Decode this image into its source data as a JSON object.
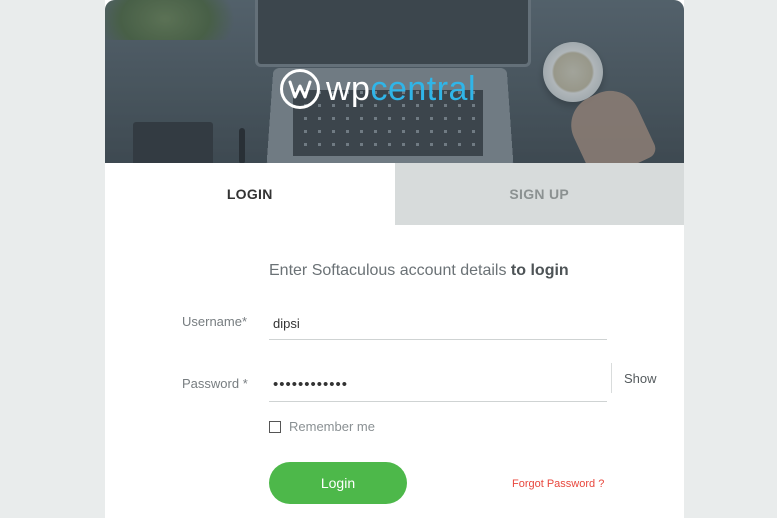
{
  "brand": {
    "logo_prefix": "wp",
    "logo_suffix": "central",
    "accent_color": "#30b5e8"
  },
  "tabs": [
    {
      "label": "LOGIN",
      "active": true
    },
    {
      "label": "SIGN UP",
      "active": false
    }
  ],
  "form": {
    "intro_text": "Enter Softaculous account details ",
    "intro_bold": "to login",
    "username": {
      "label": "Username*",
      "value": "dipsi"
    },
    "password": {
      "label": "Password *",
      "value": "dipsipass123",
      "toggle_label": "Show"
    },
    "remember_label": "Remember me",
    "remember_checked": false,
    "submit_label": "Login",
    "submit_color": "#4db84a",
    "forgot_label": "Forgot Password ?",
    "forgot_color": "#e8473d"
  }
}
